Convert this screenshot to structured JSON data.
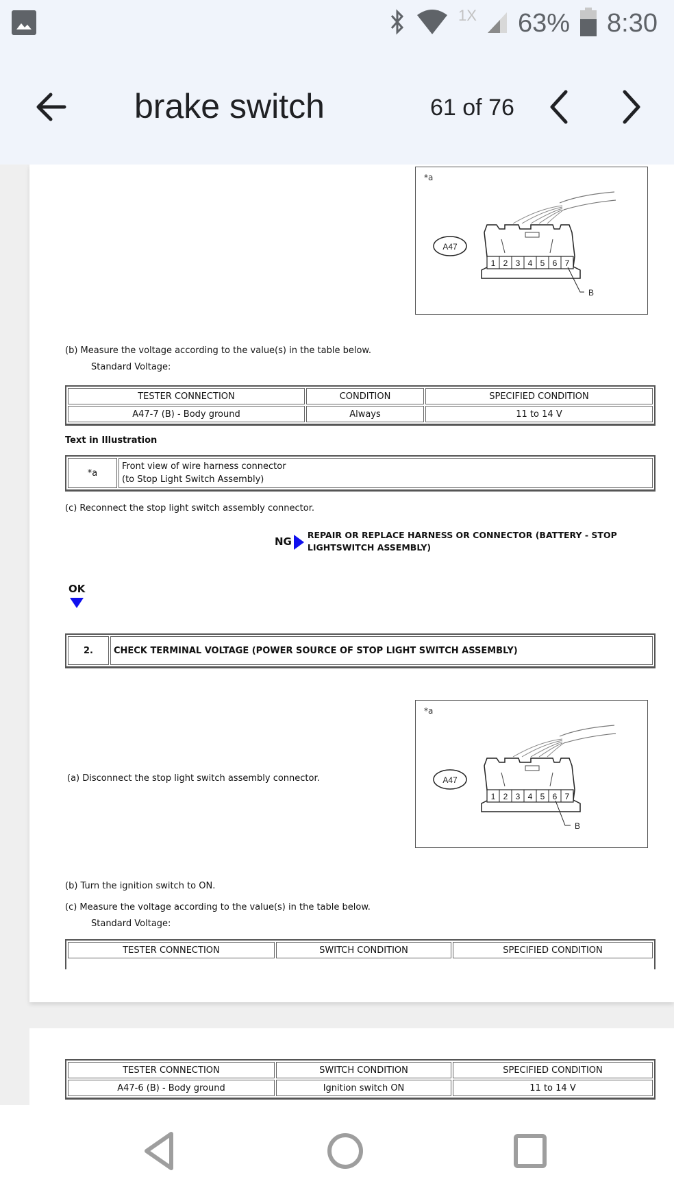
{
  "status_bar": {
    "gallery_icon": "image-icon",
    "bluetooth_icon": "bluetooth-icon",
    "wifi_icon": "wifi-icon",
    "network_label": "1X",
    "signal_icon": "signal-icon",
    "battery_percent": "63%",
    "battery_icon": "battery-icon",
    "time": "8:30"
  },
  "app_bar": {
    "back_icon": "arrow-left-icon",
    "search_query": "brake switch",
    "result_counter": "61 of 76",
    "prev_icon": "chevron-left-icon",
    "next_icon": "chevron-right-icon"
  },
  "document": {
    "figure1": {
      "label": "*a",
      "connector_id": "A47",
      "pins": [
        "1",
        "2",
        "3",
        "4",
        "5",
        "6",
        "7"
      ],
      "callout_pin": "7",
      "callout_label": "B"
    },
    "step_b": "(b) Measure the voltage according to the value(s) in the table below.",
    "standard_voltage_1": "Standard Voltage:",
    "table1": {
      "headers": [
        "TESTER CONNECTION",
        "CONDITION",
        "SPECIFIED CONDITION"
      ],
      "rows": [
        [
          "A47-7 (B) - Body ground",
          "Always",
          "11 to 14 V"
        ]
      ]
    },
    "text_in_illustration_heading": "Text in Illustration",
    "illustration_table": {
      "key": "*a",
      "line1": "Front view of wire harness connector",
      "line2": "(to Stop Light Switch Assembly)"
    },
    "step_c": "(c) Reconnect the stop light switch assembly connector.",
    "ng": {
      "label": "NG",
      "line1": "REPAIR OR REPLACE HARNESS OR CONNECTOR (BATTERY - STOP",
      "line2": "LIGHTSWITCH ASSEMBLY)"
    },
    "ok_label": "OK",
    "step2": {
      "number": "2.",
      "title": "CHECK TERMINAL VOLTAGE (POWER SOURCE OF STOP LIGHT SWITCH ASSEMBLY)"
    },
    "step2_a": "(a) Disconnect the stop light switch assembly connector.",
    "figure2": {
      "label": "*a",
      "connector_id": "A47",
      "pins": [
        "1",
        "2",
        "3",
        "4",
        "5",
        "6",
        "7"
      ],
      "callout_pin": "6",
      "callout_label": "B"
    },
    "step2_b": "(b) Turn the ignition switch to ON.",
    "step2_c": "(c) Measure the voltage according to the value(s) in the table below.",
    "standard_voltage_2": "Standard Voltage:",
    "table2_partial": {
      "headers": [
        "TESTER CONNECTION",
        "SWITCH CONDITION",
        "SPECIFIED CONDITION"
      ]
    },
    "table2_full": {
      "headers": [
        "TESTER CONNECTION",
        "SWITCH CONDITION",
        "SPECIFIED CONDITION"
      ],
      "rows": [
        [
          "A47-6 (B) - Body ground",
          "Ignition switch ON",
          "11 to 14 V"
        ]
      ]
    }
  },
  "nav_bar": {
    "back": "nav-back-icon",
    "home": "nav-home-icon",
    "recents": "nav-recents-icon"
  },
  "colors": {
    "app_bg": "#f0f4fb",
    "arrow_blue": "#1010ee",
    "nav_icon": "#9e9e9e"
  }
}
